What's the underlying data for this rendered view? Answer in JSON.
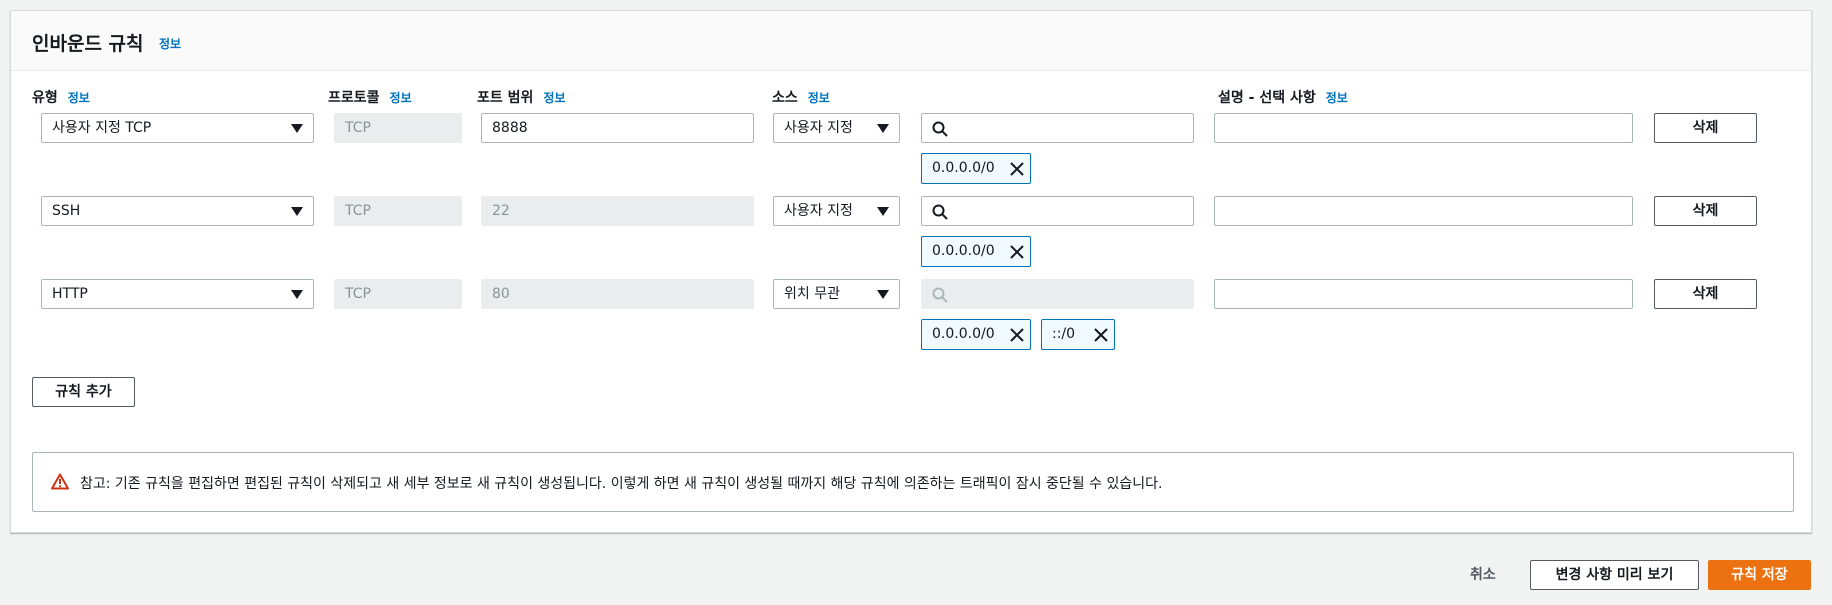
{
  "section": {
    "title": "인바운드 규칙",
    "info": "정보"
  },
  "columns": {
    "type": {
      "label": "유형",
      "info": "정보"
    },
    "protocol": {
      "label": "프로토콜",
      "info": "정보"
    },
    "port_range": {
      "label": "포트 범위",
      "info": "정보"
    },
    "source": {
      "label": "소스",
      "info": "정보"
    },
    "description": {
      "label": "설명 - 선택 사항",
      "info": "정보"
    }
  },
  "rules": [
    {
      "type": "사용자 지정 TCP",
      "protocol": "TCP",
      "port": "8888",
      "source": "사용자 지정",
      "tokens": [
        "0.0.0.0/0"
      ],
      "delete": "삭제"
    },
    {
      "type": "SSH",
      "protocol": "TCP",
      "port": "22",
      "source": "사용자 지정",
      "tokens": [
        "0.0.0.0/0"
      ],
      "delete": "삭제"
    },
    {
      "type": "HTTP",
      "protocol": "TCP",
      "port": "80",
      "source": "위치 무관",
      "tokens": [
        "0.0.0.0/0",
        "::/0"
      ],
      "delete": "삭제"
    }
  ],
  "add_rule": "규칙 추가",
  "note": "참고: 기존 규칙을 편집하면 편집된 규칙이 삭제되고 새 세부 정보로 새 규칙이 생성됩니다. 이렇게 하면 새 규칙이 생성될 때까지 해당 규칙에 의존하는 트래픽이 잠시 중단될 수 있습니다.",
  "footer": {
    "cancel": "취소",
    "preview": "변경 사항 미리 보기",
    "save": "규칙 저장"
  },
  "icons": {
    "search": "search-icon",
    "remove": "close-icon",
    "warning": "warning-icon",
    "dropdown": "caret-down-icon"
  },
  "colors": {
    "link": "#0073bb",
    "primary": "#ec7211",
    "token_border": "#0073bb",
    "token_bg": "#f1faff",
    "warning": "#d13212"
  }
}
